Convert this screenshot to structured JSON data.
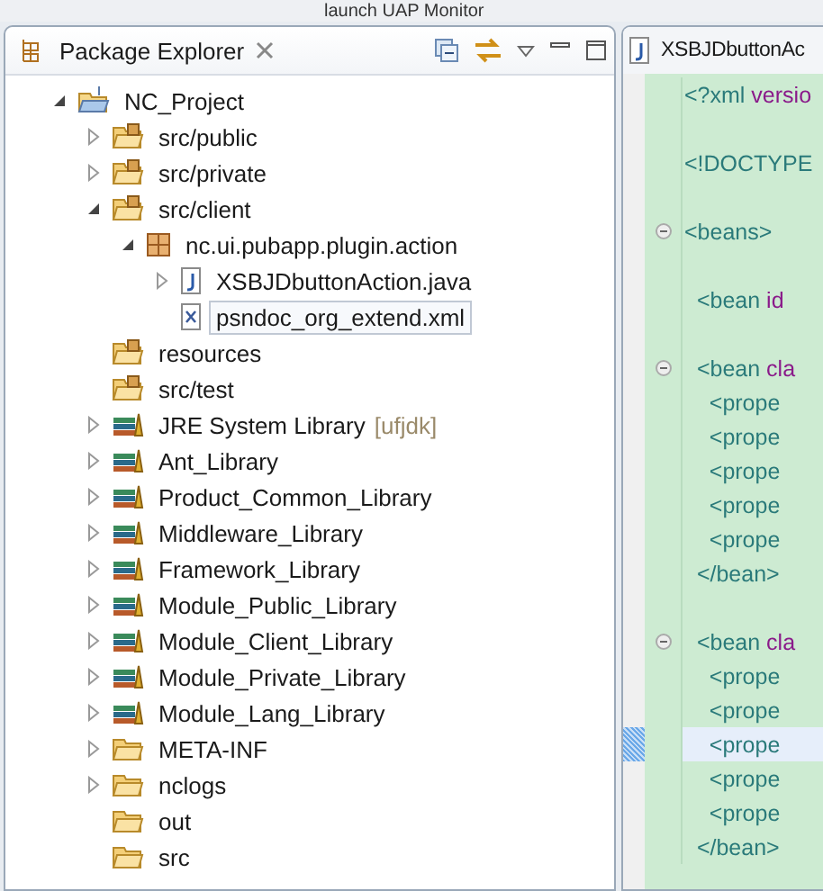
{
  "toolbar": {
    "label": "launch UAP Monitor"
  },
  "explorer": {
    "title": "Package Explorer",
    "tree": [
      {
        "label": "NC_Project",
        "kind": "project",
        "expanded": true,
        "children": [
          {
            "label": "src/public",
            "kind": "source-folder",
            "expanded": false
          },
          {
            "label": "src/private",
            "kind": "source-folder",
            "expanded": false
          },
          {
            "label": "src/client",
            "kind": "source-folder",
            "expanded": true,
            "children": [
              {
                "label": "nc.ui.pubapp.plugin.action",
                "kind": "package",
                "expanded": true,
                "children": [
                  {
                    "label": "XSBJDbuttonAction.java",
                    "kind": "java-file",
                    "expanded": false,
                    "selected": false
                  },
                  {
                    "label": "psndoc_org_extend.xml",
                    "kind": "xml-file",
                    "selected": true
                  }
                ]
              }
            ]
          },
          {
            "label": "resources",
            "kind": "source-folder"
          },
          {
            "label": "src/test",
            "kind": "source-folder"
          },
          {
            "label": "JRE System Library",
            "decoration": "[ufjdk]",
            "kind": "library",
            "expanded": false
          },
          {
            "label": "Ant_Library",
            "kind": "library",
            "expanded": false
          },
          {
            "label": "Product_Common_Library",
            "kind": "library",
            "expanded": false
          },
          {
            "label": "Middleware_Library",
            "kind": "library",
            "expanded": false
          },
          {
            "label": "Framework_Library",
            "kind": "library",
            "expanded": false
          },
          {
            "label": "Module_Public_Library",
            "kind": "library",
            "expanded": false
          },
          {
            "label": "Module_Client_Library",
            "kind": "library",
            "expanded": false
          },
          {
            "label": "Module_Private_Library",
            "kind": "library",
            "expanded": false
          },
          {
            "label": "Module_Lang_Library",
            "kind": "library",
            "expanded": false
          },
          {
            "label": "META-INF",
            "kind": "folder",
            "expanded": false
          },
          {
            "label": "nclogs",
            "kind": "folder",
            "expanded": false
          },
          {
            "label": "out",
            "kind": "folder"
          },
          {
            "label": "src",
            "kind": "folder"
          }
        ]
      }
    ]
  },
  "editor": {
    "tab": "XSBJDbuttonAc",
    "lines": [
      {
        "parts": [
          {
            "text": "<?xml",
            "kind": "tag"
          },
          {
            "text": " versio",
            "kind": "attr"
          }
        ]
      },
      {
        "blank_before": true,
        "parts": [
          {
            "text": "<!DOCTYPE",
            "kind": "tag"
          }
        ]
      },
      {
        "blank_before": true,
        "fold": true,
        "parts": [
          {
            "text": "<beans>",
            "kind": "tag"
          }
        ]
      },
      {
        "blank_before": true,
        "parts": [
          {
            "text": "  <bean",
            "kind": "tag"
          },
          {
            "text": " id",
            "kind": "attr"
          }
        ]
      },
      {
        "blank_before": true,
        "fold": true,
        "parts": [
          {
            "text": "  <bean",
            "kind": "tag"
          },
          {
            "text": " cla",
            "kind": "attr"
          }
        ]
      },
      {
        "parts": [
          {
            "text": "    <prope",
            "kind": "tag"
          }
        ]
      },
      {
        "parts": [
          {
            "text": "    <prope",
            "kind": "tag"
          }
        ]
      },
      {
        "parts": [
          {
            "text": "    <prope",
            "kind": "tag"
          }
        ]
      },
      {
        "parts": [
          {
            "text": "    <prope",
            "kind": "tag"
          }
        ]
      },
      {
        "parts": [
          {
            "text": "    <prope",
            "kind": "tag"
          }
        ]
      },
      {
        "parts": [
          {
            "text": "  </bean>",
            "kind": "tag"
          }
        ]
      },
      {
        "blank_before": true,
        "fold": true,
        "parts": [
          {
            "text": "  <bean",
            "kind": "tag"
          },
          {
            "text": " cla",
            "kind": "attr"
          }
        ]
      },
      {
        "parts": [
          {
            "text": "    <prope",
            "kind": "tag"
          }
        ]
      },
      {
        "parts": [
          {
            "text": "    <prope",
            "kind": "tag"
          }
        ]
      },
      {
        "current": true,
        "parts": [
          {
            "text": "    <prope",
            "kind": "tag"
          }
        ]
      },
      {
        "parts": [
          {
            "text": "    <prope",
            "kind": "tag"
          }
        ]
      },
      {
        "parts": [
          {
            "text": "    <prope",
            "kind": "tag"
          }
        ]
      },
      {
        "parts": [
          {
            "text": "  </bean>",
            "kind": "tag"
          }
        ]
      }
    ]
  }
}
